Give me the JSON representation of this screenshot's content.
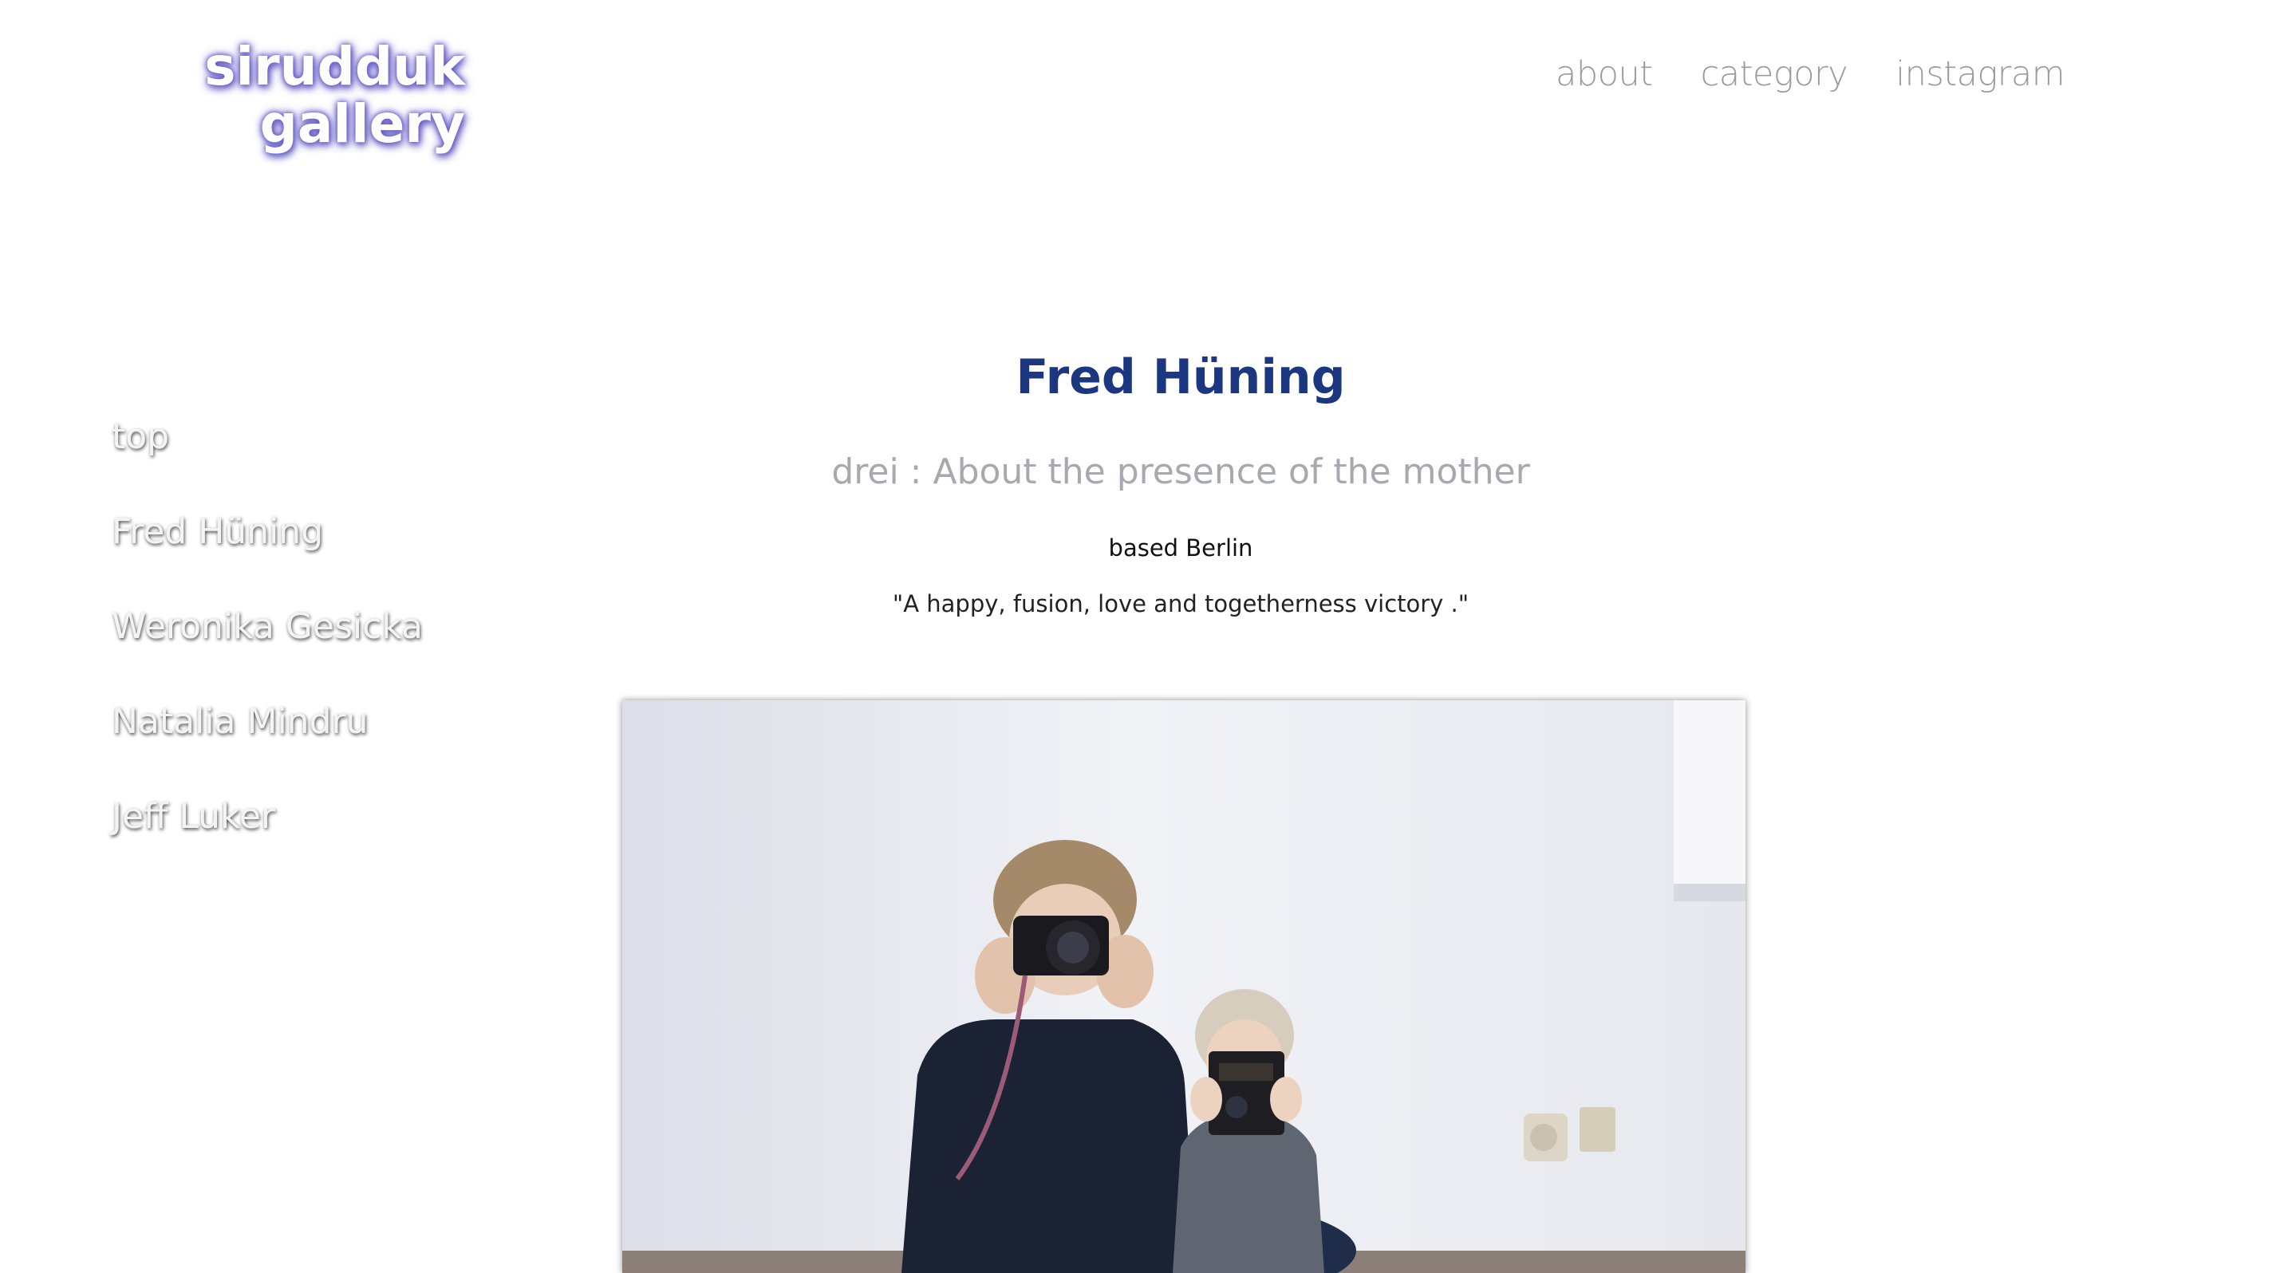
{
  "logo": {
    "line1": "sirudduk",
    "line2": "gallery"
  },
  "top_nav": {
    "items": [
      {
        "label": "about"
      },
      {
        "label": "category"
      },
      {
        "label": "instagram"
      }
    ]
  },
  "side_nav": {
    "items": [
      {
        "label": "top"
      },
      {
        "label": "Fred Hüning"
      },
      {
        "label": "Weronika Gesicka"
      },
      {
        "label": "Natalia Mindru"
      },
      {
        "label": "Jeff Luker"
      }
    ]
  },
  "main": {
    "artist_name": "Fred Hüning",
    "series_title": "drei : About the presence of the mother",
    "based": "based Berlin",
    "quote": "\"A happy, fusion, love and togetherness victory .\""
  },
  "colors": {
    "artist_name": "#1a3780",
    "logo_glow": "#5b52c7",
    "nav_text": "#9b9b9b"
  }
}
